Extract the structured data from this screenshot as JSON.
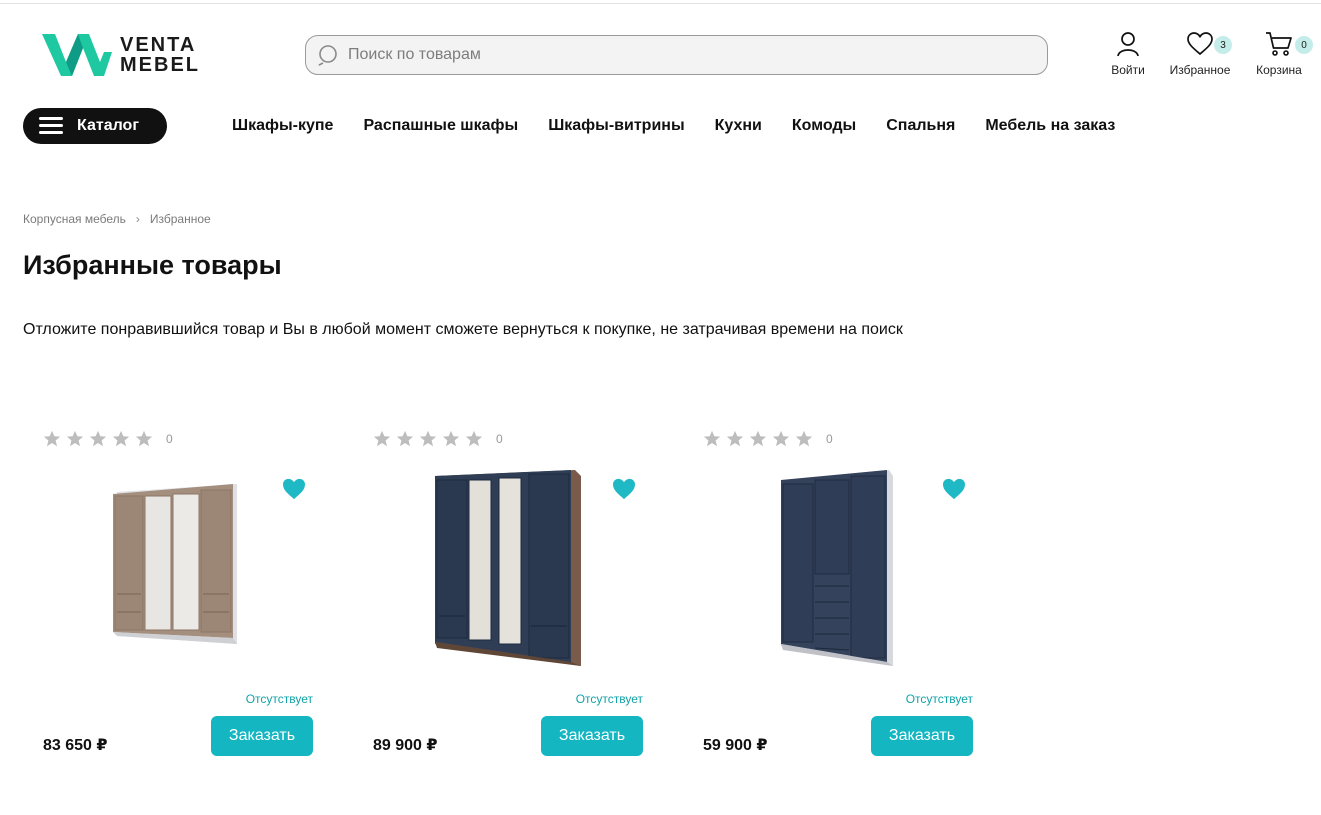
{
  "header": {
    "logo_line1": "VENTA",
    "logo_line2": "MEBEL",
    "search_placeholder": "Поиск по товарам",
    "login_label": "Войти",
    "favorites_label": "Избранное",
    "favorites_count": "3",
    "cart_label": "Корзина",
    "cart_count": "0"
  },
  "nav": {
    "catalog_label": "Каталог",
    "items": [
      "Шкафы-купе",
      "Распашные шкафы",
      "Шкафы-витрины",
      "Кухни",
      "Комоды",
      "Спальня",
      "Мебель на заказ"
    ]
  },
  "breadcrumb": {
    "items": [
      "Корпусная мебель",
      "Избранное"
    ],
    "separator": "›"
  },
  "page": {
    "title": "Избранные товары",
    "intro": "Отложите понравившийся товар и Вы в любой момент сможете вернуться к покупке, не затрачивая времени на поиск"
  },
  "products": [
    {
      "rating_count": "0",
      "rating": 0,
      "availability": "Отсутствует",
      "price": "83 650 ₽",
      "order_label": "Заказать",
      "image": "wardrobe-beige-mirror",
      "facade_color": "#a48e7e"
    },
    {
      "rating_count": "0",
      "rating": 0,
      "availability": "Отсутствует",
      "price": "89 900 ₽",
      "order_label": "Заказать",
      "image": "wardrobe-navy-mirror",
      "facade_color": "#2f3d55"
    },
    {
      "rating_count": "0",
      "rating": 0,
      "availability": "Отсутствует",
      "price": "59 900 ₽",
      "order_label": "Заказать",
      "image": "wardrobe-navy-drawers",
      "facade_color": "#34425b"
    }
  ],
  "colors": {
    "accent": "#14b6c1",
    "heart": "#1fb9c5",
    "badge_bg": "#c4ede9",
    "logo_green": "#1ec8a0"
  }
}
